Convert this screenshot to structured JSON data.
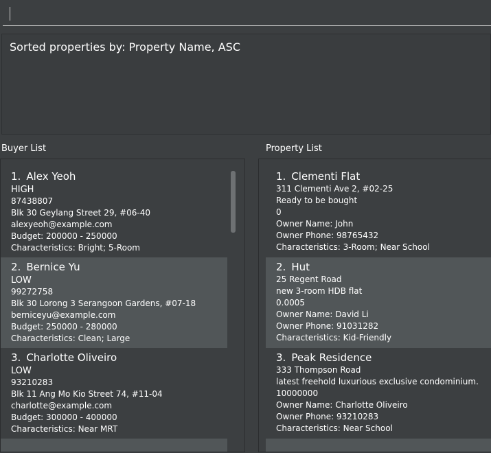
{
  "command": {
    "value": ""
  },
  "result": {
    "text": "Sorted properties by: Property Name, ASC"
  },
  "buyer_list": {
    "title": "Buyer List",
    "items": [
      {
        "index": "1.",
        "name": "Alex Yeoh",
        "priority": "HIGH",
        "phone": "87438807",
        "address": "Blk 30 Geylang Street 29, #06-40",
        "email": "alexyeoh@example.com",
        "budget": "Budget: 200000 - 250000",
        "characteristics": "Characteristics: Bright; 5-Room"
      },
      {
        "index": "2.",
        "name": "Bernice Yu",
        "priority": "LOW",
        "phone": "99272758",
        "address": "Blk 30 Lorong 3 Serangoon Gardens, #07-18",
        "email": "berniceyu@example.com",
        "budget": "Budget: 250000 - 280000",
        "characteristics": "Characteristics: Clean; Large"
      },
      {
        "index": "3.",
        "name": "Charlotte Oliveiro",
        "priority": "LOW",
        "phone": "93210283",
        "address": "Blk 11 Ang Mo Kio Street 74, #11-04",
        "email": "charlotte@example.com",
        "budget": "Budget: 300000 - 400000",
        "characteristics": "Characteristics: Near MRT"
      }
    ]
  },
  "property_list": {
    "title": "Property List",
    "items": [
      {
        "index": "1.",
        "name": "Clementi Flat",
        "address": "311 Clementi Ave 2, #02-25",
        "description": "Ready to be bought",
        "price": "0",
        "owner_name": "Owner Name: John",
        "owner_phone": "Owner Phone: 98765432",
        "characteristics": "Characteristics: 3-Room; Near School"
      },
      {
        "index": "2.",
        "name": "Hut",
        "address": "25 Regent Road",
        "description": "new 3-room HDB flat",
        "price": "0.0005",
        "owner_name": "Owner Name: David Li",
        "owner_phone": "Owner Phone: 91031282",
        "characteristics": "Characteristics: Kid-Friendly"
      },
      {
        "index": "3.",
        "name": "Peak Residence",
        "address": "333 Thompson Road",
        "description": "latest freehold luxurious exclusive condominium.",
        "price": "10000000",
        "owner_name": "Owner Name: Charlotte Oliveiro",
        "owner_phone": "Owner Phone: 93210283",
        "characteristics": "Characteristics: Near School"
      }
    ]
  }
}
